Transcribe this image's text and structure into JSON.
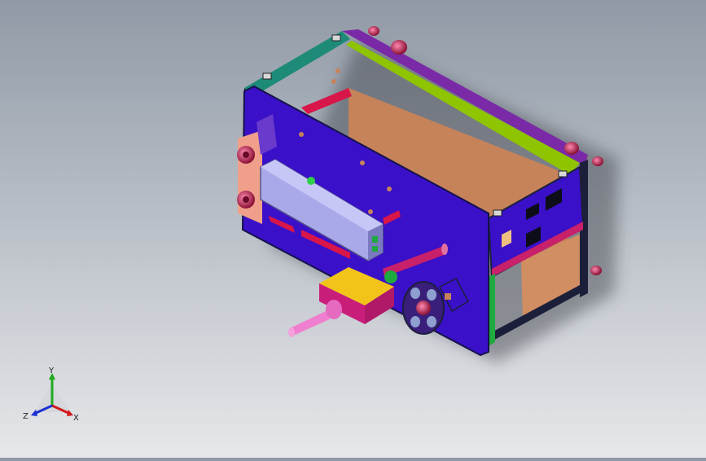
{
  "viewport": {
    "background_top": "#909aa6",
    "background_bottom": "#e6e7ea"
  },
  "model": {
    "colors": {
      "front_panel": "#3a10c8",
      "frame_dark": "#1c1f3a",
      "green_panel": "#8fc400",
      "inner_panel": "#c6835a",
      "purple_rail": "#7a2aa6",
      "magenta": "#c8206a",
      "teal": "#1e8a78",
      "yellow_box": "#f2c41a",
      "pink_handle": "#f07fcf",
      "lavender": "#a9a9ea",
      "red_brace": "#d8164a"
    }
  },
  "triad": {
    "x_label": "X",
    "y_label": "Y",
    "z_label": "Z",
    "x_color": "#d21a1a",
    "y_color": "#1eaa1e",
    "z_color": "#1a2fd2"
  }
}
